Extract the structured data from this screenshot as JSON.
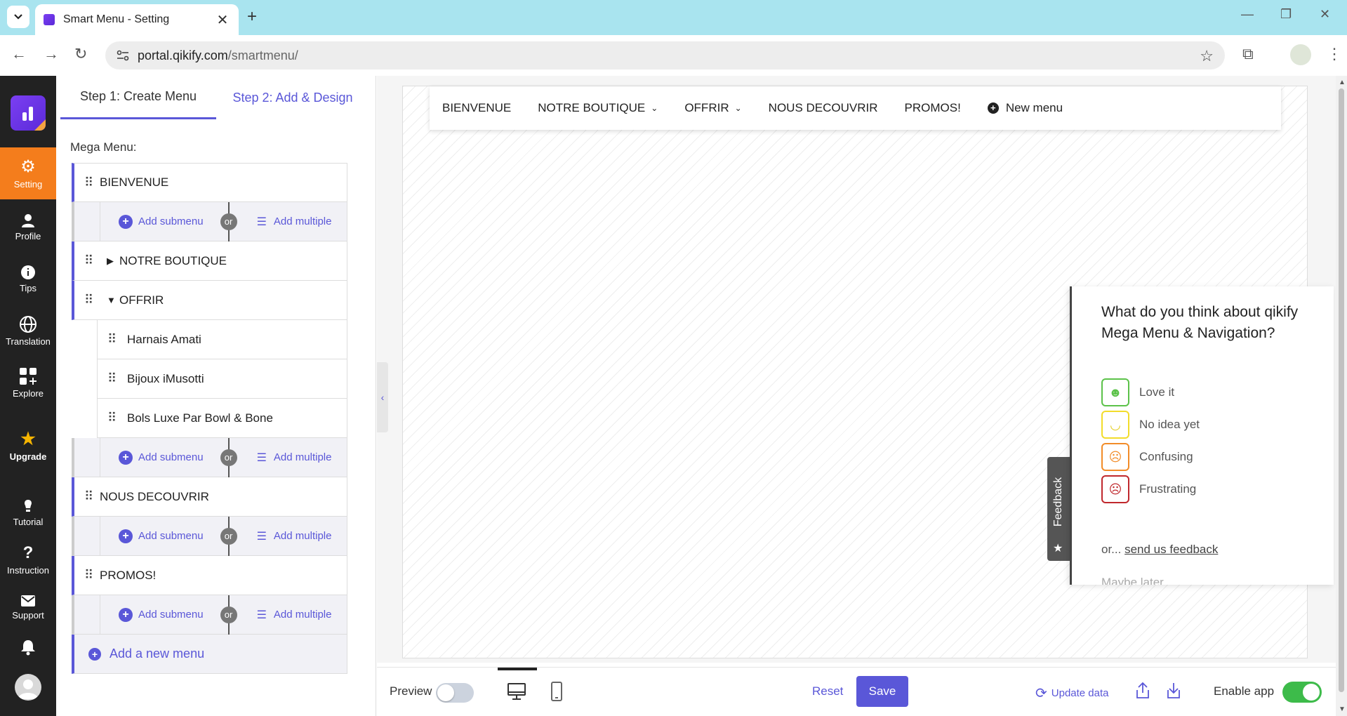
{
  "browser": {
    "tab_title": "Smart Menu - Setting",
    "new_tab": "+",
    "url_domain": "portal.qikify.com",
    "url_path": "/smartmenu/"
  },
  "sidebar": {
    "items": [
      {
        "label": "Setting",
        "icon": "gear-icon"
      },
      {
        "label": "Profile",
        "icon": "user-icon"
      },
      {
        "label": "Tips",
        "icon": "info-icon"
      },
      {
        "label": "Translation",
        "icon": "globe-icon"
      },
      {
        "label": "Explore",
        "icon": "grid-plus-icon"
      },
      {
        "label": "Upgrade",
        "icon": "star-icon"
      },
      {
        "label": "Tutorial",
        "icon": "bulb-icon"
      },
      {
        "label": "Instruction",
        "icon": "question-icon"
      },
      {
        "label": "Support",
        "icon": "mail-icon"
      }
    ],
    "accent_color": "#f47d1c"
  },
  "steps": {
    "step1": "Step 1: Create Menu",
    "step2": "Step 2: Add & Design"
  },
  "mega_menu": {
    "title": "Mega Menu:",
    "items": {
      "bienvenue": "BIENVENUE",
      "boutique": "NOTRE BOUTIQUE",
      "offrir": "OFFRIR",
      "offrir_sub": [
        "Harnais Amati",
        "Bijoux iMusotti",
        "Bols Luxe Par Bowl & Bone"
      ],
      "decouvrir": "NOUS DECOUVRIR",
      "promos": "PROMOS!"
    },
    "add_submenu": "Add submenu",
    "or": "or",
    "add_multiple": "Add multiple",
    "add_new_menu": "Add a new menu"
  },
  "preview_nav": {
    "items": [
      "BIENVENUE",
      "NOTRE BOUTIQUE",
      "OFFRIR",
      "NOUS DECOUVRIR",
      "PROMOS!"
    ],
    "new_menu": "New menu"
  },
  "feedback": {
    "tab_label": "Feedback",
    "title": "What do you think about qikify Mega Menu & Navigation?",
    "options": [
      "Love it",
      "No idea yet",
      "Confusing",
      "Frustrating"
    ],
    "or_prefix": "or...",
    "send_link": "send us feedback",
    "later": "Maybe later"
  },
  "bottom": {
    "preview_label": "Preview",
    "reset": "Reset",
    "save": "Save",
    "update_data": "Update data",
    "enable_app": "Enable app"
  },
  "colors": {
    "primary": "#5a57d8",
    "toggle_on": "#3dbb4a"
  }
}
